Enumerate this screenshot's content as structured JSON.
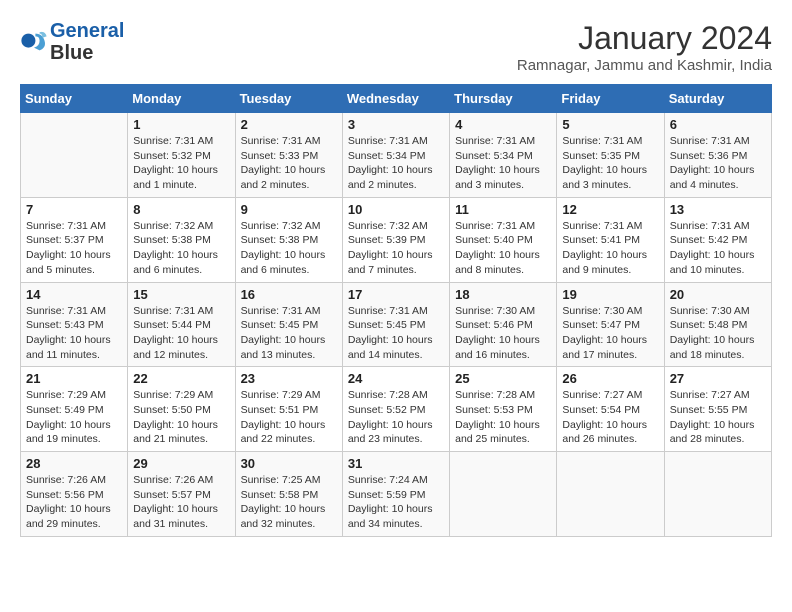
{
  "header": {
    "logo_line1": "General",
    "logo_line2": "Blue",
    "month": "January 2024",
    "location": "Ramnagar, Jammu and Kashmir, India"
  },
  "days_of_week": [
    "Sunday",
    "Monday",
    "Tuesday",
    "Wednesday",
    "Thursday",
    "Friday",
    "Saturday"
  ],
  "weeks": [
    [
      {
        "num": "",
        "info": ""
      },
      {
        "num": "1",
        "info": "Sunrise: 7:31 AM\nSunset: 5:32 PM\nDaylight: 10 hours\nand 1 minute."
      },
      {
        "num": "2",
        "info": "Sunrise: 7:31 AM\nSunset: 5:33 PM\nDaylight: 10 hours\nand 2 minutes."
      },
      {
        "num": "3",
        "info": "Sunrise: 7:31 AM\nSunset: 5:34 PM\nDaylight: 10 hours\nand 2 minutes."
      },
      {
        "num": "4",
        "info": "Sunrise: 7:31 AM\nSunset: 5:34 PM\nDaylight: 10 hours\nand 3 minutes."
      },
      {
        "num": "5",
        "info": "Sunrise: 7:31 AM\nSunset: 5:35 PM\nDaylight: 10 hours\nand 3 minutes."
      },
      {
        "num": "6",
        "info": "Sunrise: 7:31 AM\nSunset: 5:36 PM\nDaylight: 10 hours\nand 4 minutes."
      }
    ],
    [
      {
        "num": "7",
        "info": "Sunrise: 7:31 AM\nSunset: 5:37 PM\nDaylight: 10 hours\nand 5 minutes."
      },
      {
        "num": "8",
        "info": "Sunrise: 7:32 AM\nSunset: 5:38 PM\nDaylight: 10 hours\nand 6 minutes."
      },
      {
        "num": "9",
        "info": "Sunrise: 7:32 AM\nSunset: 5:38 PM\nDaylight: 10 hours\nand 6 minutes."
      },
      {
        "num": "10",
        "info": "Sunrise: 7:32 AM\nSunset: 5:39 PM\nDaylight: 10 hours\nand 7 minutes."
      },
      {
        "num": "11",
        "info": "Sunrise: 7:31 AM\nSunset: 5:40 PM\nDaylight: 10 hours\nand 8 minutes."
      },
      {
        "num": "12",
        "info": "Sunrise: 7:31 AM\nSunset: 5:41 PM\nDaylight: 10 hours\nand 9 minutes."
      },
      {
        "num": "13",
        "info": "Sunrise: 7:31 AM\nSunset: 5:42 PM\nDaylight: 10 hours\nand 10 minutes."
      }
    ],
    [
      {
        "num": "14",
        "info": "Sunrise: 7:31 AM\nSunset: 5:43 PM\nDaylight: 10 hours\nand 11 minutes."
      },
      {
        "num": "15",
        "info": "Sunrise: 7:31 AM\nSunset: 5:44 PM\nDaylight: 10 hours\nand 12 minutes."
      },
      {
        "num": "16",
        "info": "Sunrise: 7:31 AM\nSunset: 5:45 PM\nDaylight: 10 hours\nand 13 minutes."
      },
      {
        "num": "17",
        "info": "Sunrise: 7:31 AM\nSunset: 5:45 PM\nDaylight: 10 hours\nand 14 minutes."
      },
      {
        "num": "18",
        "info": "Sunrise: 7:30 AM\nSunset: 5:46 PM\nDaylight: 10 hours\nand 16 minutes."
      },
      {
        "num": "19",
        "info": "Sunrise: 7:30 AM\nSunset: 5:47 PM\nDaylight: 10 hours\nand 17 minutes."
      },
      {
        "num": "20",
        "info": "Sunrise: 7:30 AM\nSunset: 5:48 PM\nDaylight: 10 hours\nand 18 minutes."
      }
    ],
    [
      {
        "num": "21",
        "info": "Sunrise: 7:29 AM\nSunset: 5:49 PM\nDaylight: 10 hours\nand 19 minutes."
      },
      {
        "num": "22",
        "info": "Sunrise: 7:29 AM\nSunset: 5:50 PM\nDaylight: 10 hours\nand 21 minutes."
      },
      {
        "num": "23",
        "info": "Sunrise: 7:29 AM\nSunset: 5:51 PM\nDaylight: 10 hours\nand 22 minutes."
      },
      {
        "num": "24",
        "info": "Sunrise: 7:28 AM\nSunset: 5:52 PM\nDaylight: 10 hours\nand 23 minutes."
      },
      {
        "num": "25",
        "info": "Sunrise: 7:28 AM\nSunset: 5:53 PM\nDaylight: 10 hours\nand 25 minutes."
      },
      {
        "num": "26",
        "info": "Sunrise: 7:27 AM\nSunset: 5:54 PM\nDaylight: 10 hours\nand 26 minutes."
      },
      {
        "num": "27",
        "info": "Sunrise: 7:27 AM\nSunset: 5:55 PM\nDaylight: 10 hours\nand 28 minutes."
      }
    ],
    [
      {
        "num": "28",
        "info": "Sunrise: 7:26 AM\nSunset: 5:56 PM\nDaylight: 10 hours\nand 29 minutes."
      },
      {
        "num": "29",
        "info": "Sunrise: 7:26 AM\nSunset: 5:57 PM\nDaylight: 10 hours\nand 31 minutes."
      },
      {
        "num": "30",
        "info": "Sunrise: 7:25 AM\nSunset: 5:58 PM\nDaylight: 10 hours\nand 32 minutes."
      },
      {
        "num": "31",
        "info": "Sunrise: 7:24 AM\nSunset: 5:59 PM\nDaylight: 10 hours\nand 34 minutes."
      },
      {
        "num": "",
        "info": ""
      },
      {
        "num": "",
        "info": ""
      },
      {
        "num": "",
        "info": ""
      }
    ]
  ]
}
